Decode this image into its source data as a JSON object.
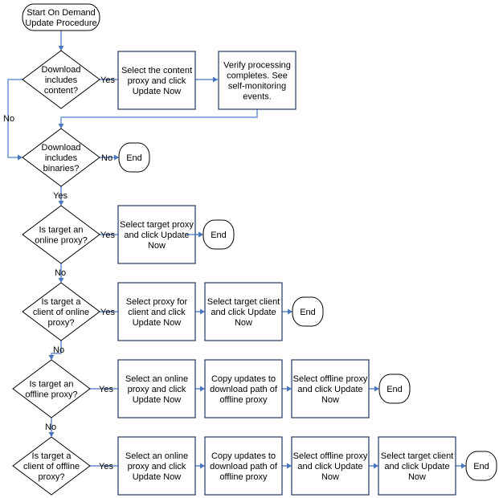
{
  "diagram": {
    "type": "flowchart",
    "colors": {
      "connector": "#4a76c0",
      "box_border": "#1f3864",
      "shape_border": "#000000"
    },
    "start": {
      "id": "start",
      "lines": [
        "Start On Demand",
        "Update Procedure"
      ]
    },
    "decisions": [
      {
        "id": "d1",
        "lines": [
          "Download",
          "includes",
          "content?"
        ]
      },
      {
        "id": "d2",
        "lines": [
          "Download",
          "includes",
          "binaries?"
        ]
      },
      {
        "id": "d3",
        "lines": [
          "Is target an",
          "online proxy?"
        ]
      },
      {
        "id": "d4",
        "lines": [
          "Is target a",
          "client of online",
          "proxy?"
        ]
      },
      {
        "id": "d5",
        "lines": [
          "Is target an",
          "offline proxy?"
        ]
      },
      {
        "id": "d6",
        "lines": [
          "Is target a",
          "client of offline",
          "proxy?"
        ]
      }
    ],
    "processes": [
      {
        "id": "p1",
        "lines": [
          "Select the content",
          "proxy and click",
          "Update Now"
        ]
      },
      {
        "id": "p2",
        "lines": [
          "Verify processing",
          "completes. See",
          "self-monitoring",
          "events."
        ]
      },
      {
        "id": "p3",
        "lines": [
          "Select target proxy",
          "and click Update",
          "Now"
        ]
      },
      {
        "id": "p4",
        "lines": [
          "Select proxy for",
          "client and click",
          "Update Now"
        ]
      },
      {
        "id": "p5",
        "lines": [
          "Select target client",
          "and click Update",
          "Now"
        ]
      },
      {
        "id": "p6",
        "lines": [
          "Select an online",
          "proxy and click",
          "Update Now"
        ]
      },
      {
        "id": "p7",
        "lines": [
          "Copy updates to",
          "download path of",
          "offline proxy"
        ]
      },
      {
        "id": "p8",
        "lines": [
          "Select offline proxy",
          "and click Update",
          "Now"
        ]
      },
      {
        "id": "p9",
        "lines": [
          "Select an online",
          "proxy and click",
          "Update Now"
        ]
      },
      {
        "id": "p10",
        "lines": [
          "Copy updates to",
          "download path of",
          "offline proxy"
        ]
      },
      {
        "id": "p11",
        "lines": [
          "Select offline proxy",
          "and click Update",
          "Now"
        ]
      },
      {
        "id": "p12",
        "lines": [
          "Select target client",
          "and click Update",
          "Now"
        ]
      }
    ],
    "ends": [
      {
        "id": "e1",
        "label": "End"
      },
      {
        "id": "e2",
        "label": "End"
      },
      {
        "id": "e3",
        "label": "End"
      },
      {
        "id": "e4",
        "label": "End"
      },
      {
        "id": "e5",
        "label": "End"
      }
    ],
    "edge_labels": {
      "yes": "Yes",
      "no": "No"
    },
    "edges": [
      {
        "from": "start",
        "to": "d1"
      },
      {
        "from": "d1",
        "to": "p1",
        "label": "Yes"
      },
      {
        "from": "p1",
        "to": "p2"
      },
      {
        "from": "p2",
        "to": "d2"
      },
      {
        "from": "d1",
        "to": "d2",
        "label": "No"
      },
      {
        "from": "d2",
        "to": "e1",
        "label": "No"
      },
      {
        "from": "d2",
        "to": "d3",
        "label": "Yes"
      },
      {
        "from": "d3",
        "to": "p3",
        "label": "Yes"
      },
      {
        "from": "p3",
        "to": "e2"
      },
      {
        "from": "d3",
        "to": "d4",
        "label": "No"
      },
      {
        "from": "d4",
        "to": "p4",
        "label": "Yes"
      },
      {
        "from": "p4",
        "to": "p5"
      },
      {
        "from": "p5",
        "to": "e3"
      },
      {
        "from": "d4",
        "to": "d5",
        "label": "No"
      },
      {
        "from": "d5",
        "to": "p6",
        "label": "Yes"
      },
      {
        "from": "p6",
        "to": "p7"
      },
      {
        "from": "p7",
        "to": "p8"
      },
      {
        "from": "p8",
        "to": "e4"
      },
      {
        "from": "d5",
        "to": "d6",
        "label": "No"
      },
      {
        "from": "d6",
        "to": "p9",
        "label": "Yes"
      },
      {
        "from": "p9",
        "to": "p10"
      },
      {
        "from": "p10",
        "to": "p11"
      },
      {
        "from": "p11",
        "to": "p12"
      },
      {
        "from": "p12",
        "to": "e5"
      }
    ]
  }
}
